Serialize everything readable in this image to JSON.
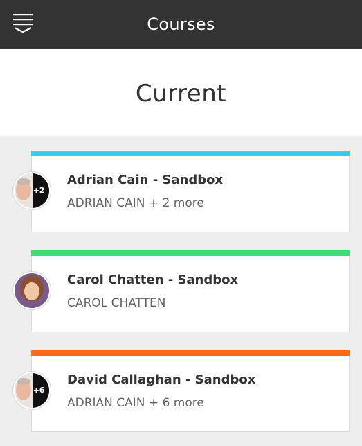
{
  "header": {
    "title": "Courses",
    "menu_icon": "menu-icon"
  },
  "section": {
    "title": "Current"
  },
  "courses": [
    {
      "title": "Adrian Cain - Sandbox",
      "instructors": "ADRIAN CAIN + 2 more",
      "color": "#2fd0f0",
      "avatar_badge": "+2"
    },
    {
      "title": "Carol Chatten - Sandbox",
      "instructors": "CAROL CHATTEN",
      "color": "#3ddc74",
      "avatar_badge": ""
    },
    {
      "title": "David Callaghan - Sandbox",
      "instructors": "ADRIAN CAIN + 6 more",
      "color": "#ff6a14",
      "avatar_badge": "+6"
    }
  ]
}
